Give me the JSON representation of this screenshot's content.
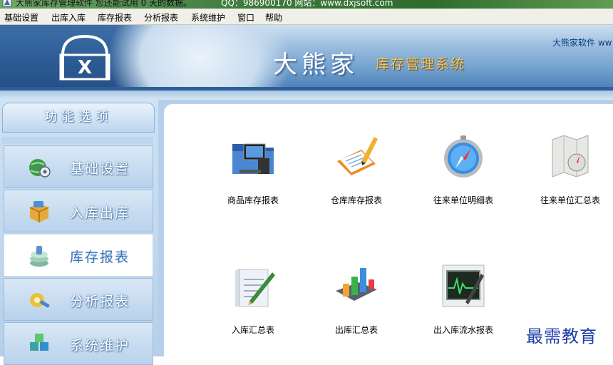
{
  "window": {
    "title": "大熊家库存管理软件  您还能试用 0 天的数据。",
    "contact": "QQ：986900170 网站：www.dxjsoft.com"
  },
  "menu": [
    "基础设置",
    "出库入库",
    "库存报表",
    "分析报表",
    "系统维护",
    "窗口",
    "帮助"
  ],
  "banner": {
    "brand": "大熊家",
    "subtitle": "库存管理系统",
    "vendor": "大熊家软件  ww"
  },
  "sidebar": {
    "header": "功能选项",
    "items": [
      {
        "label": "基础设置",
        "icon": "globe-gear-icon",
        "active": false
      },
      {
        "label": "入库出库",
        "icon": "box-icon",
        "active": false
      },
      {
        "label": "库存报表",
        "icon": "stacked-papers-icon",
        "active": true
      },
      {
        "label": "分析报表",
        "icon": "gear-wrench-icon",
        "active": false
      },
      {
        "label": "系统维护",
        "icon": "cubes-icon",
        "active": false
      }
    ]
  },
  "tiles": [
    {
      "label": "商品库存报表",
      "icon": "folder-computer-icon"
    },
    {
      "label": "仓库库存报表",
      "icon": "clipboard-pencil-icon"
    },
    {
      "label": "往来单位明细表",
      "icon": "compass-icon"
    },
    {
      "label": "往来单位汇总表",
      "icon": "map-compass-icon"
    },
    {
      "label": "入库汇总表",
      "icon": "document-pen-icon"
    },
    {
      "label": "出库汇总表",
      "icon": "bar-chart-icon"
    },
    {
      "label": "出入库流水报表",
      "icon": "monitor-pen-icon"
    }
  ],
  "watermark": "最需教育",
  "colors": {
    "accent": "#3b76b8",
    "banner_dark": "#2b5a93",
    "subtitle_gold": "#e9c56b"
  }
}
